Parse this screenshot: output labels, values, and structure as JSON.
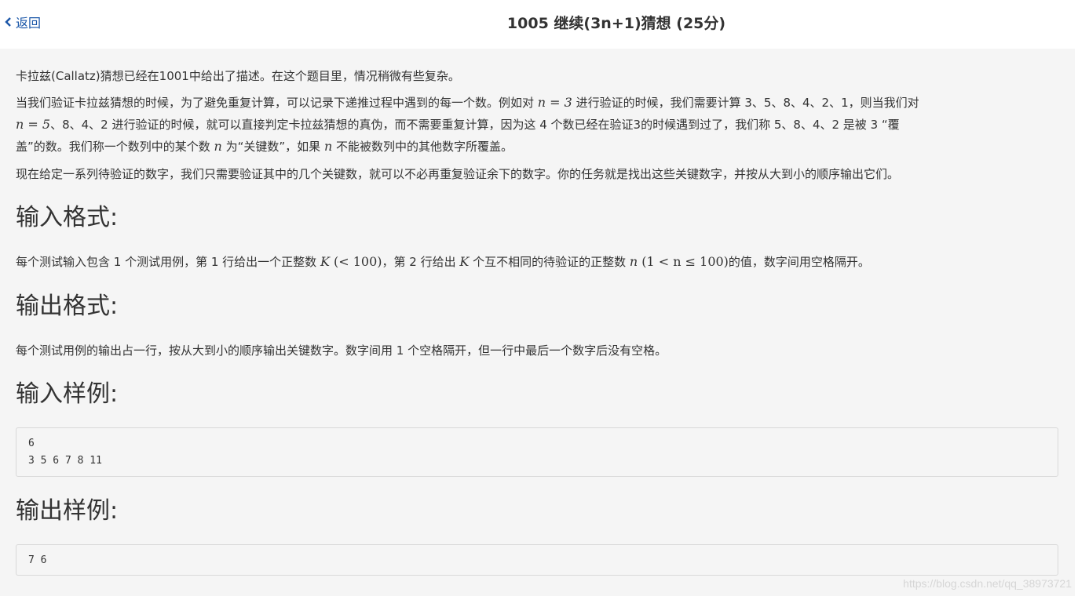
{
  "header": {
    "back_label": "返回",
    "title": "1005 继续(3n+1)猜想 (25分)"
  },
  "description": {
    "p1": "卡拉兹(Callatz)猜想已经在1001中给出了描述。在这个题目里，情况稍微有些复杂。",
    "p2_line1_a": "当我们验证卡拉兹猜想的时候，为了避免重复计算，可以记录下递推过程中遇到的每一个数。例如对 ",
    "p2_line1_math": "n = 3",
    "p2_line1_b": " 进行验证的时候，我们需要计算 3、5、8、4、2、1，则当我们对",
    "p2_line2_math": "n = 5",
    "p2_line2_b": "、8、4、2 进行验证的时候，就可以直接判定卡拉兹猜想的真伪，而不需要重复计算，因为这 4 个数已经在验证3的时候遇到过了，我们称 5、8、4、2 是被 3 “覆",
    "p2_line3_a": "盖”的数。我们称一个数列中的某个数 ",
    "p2_line3_n1": "n",
    "p2_line3_b": " 为“关键数”，如果 ",
    "p2_line3_n2": "n",
    "p2_line3_c": " 不能被数列中的其他数字所覆盖。",
    "p3": "现在给定一系列待验证的数字，我们只需要验证其中的几个关键数，就可以不必再重复验证余下的数字。你的任务就是找出这些关键数字，并按从大到小的顺序输出它们。"
  },
  "input_format": {
    "heading": "输入格式:",
    "text_a": "每个测试输入包含 1 个测试用例，第 1 行给出一个正整数 ",
    "math_K1": "K",
    "math_lt100": " (< 100)",
    "text_b": "，第 2 行给出 ",
    "math_K2": "K",
    "text_c": " 个互不相同的待验证的正整数 ",
    "math_n": "n",
    "math_range": " (1 < n ≤ 100)",
    "text_d": "的值，数字间用空格隔开。"
  },
  "output_format": {
    "heading": "输出格式:",
    "text": "每个测试用例的输出占一行，按从大到小的顺序输出关键数字。数字间用 1 个空格隔开，但一行中最后一个数字后没有空格。"
  },
  "sample_input": {
    "heading": "输入样例:",
    "lines": [
      "6",
      "3 5 6 7 8 11"
    ]
  },
  "sample_output": {
    "heading": "输出样例:",
    "lines": [
      "7 6"
    ]
  },
  "watermark": "https://blog.csdn.net/qq_38973721",
  "colors": {
    "link": "#1a56a8",
    "panel_bg": "#f5f5f5",
    "text": "#333333"
  }
}
